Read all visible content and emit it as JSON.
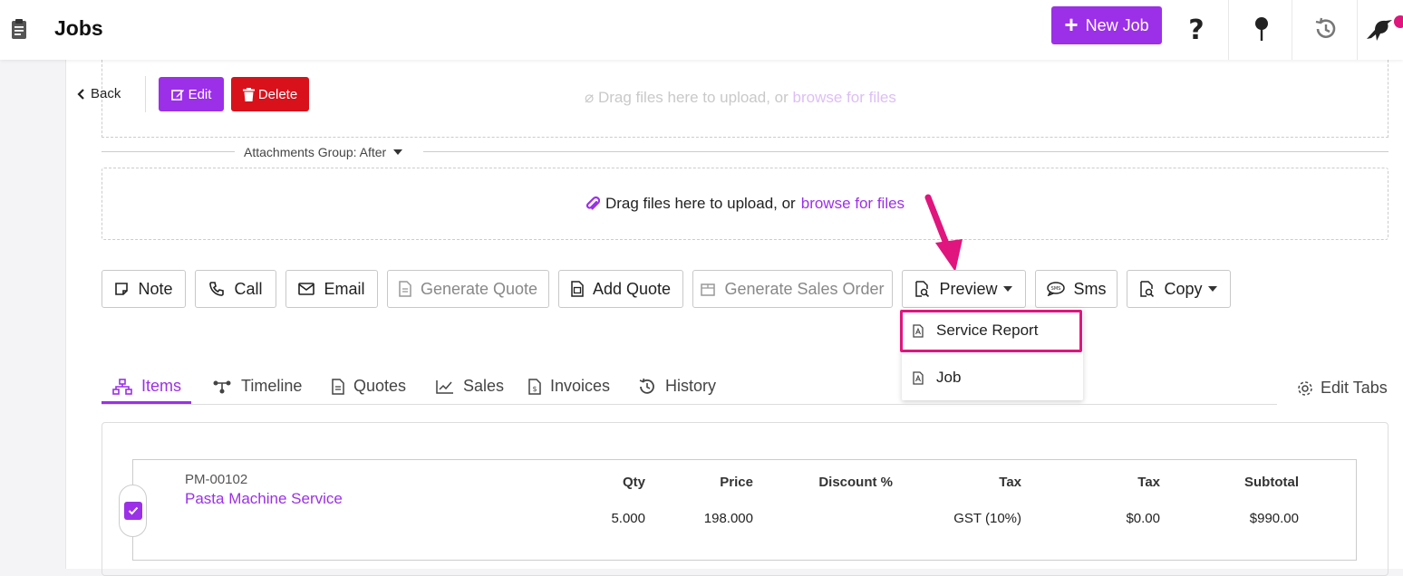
{
  "header": {
    "title": "Jobs",
    "new_job_label": "New Job"
  },
  "toolbar": {
    "back_label": "Back",
    "edit_label": "Edit",
    "delete_label": "Delete"
  },
  "attachments": {
    "faded_text": "Drag files here to upload, or",
    "faded_link": "browse for files",
    "group_label": "Attachments Group: After",
    "drop_text": "Drag files here to upload, or",
    "drop_link": "browse for files"
  },
  "actions": {
    "note": "Note",
    "call": "Call",
    "email": "Email",
    "generate_quote": "Generate Quote",
    "add_quote": "Add Quote",
    "generate_sales_order": "Generate Sales Order",
    "preview": "Preview",
    "sms": "Sms",
    "copy": "Copy"
  },
  "preview_menu": {
    "items": [
      "Service Report",
      "Job"
    ]
  },
  "tabs": {
    "items": [
      "Items",
      "Timeline",
      "Quotes",
      "Sales",
      "Invoices",
      "History"
    ],
    "edit_tabs": "Edit Tabs"
  },
  "item": {
    "sku": "PM-00102",
    "name": "Pasta Machine Service",
    "headers": {
      "qty": "Qty",
      "price": "Price",
      "discount": "Discount %",
      "tax": "Tax",
      "tax_amount": "Tax",
      "subtotal": "Subtotal"
    },
    "values": {
      "qty": "5.000",
      "price": "198.000",
      "tax": "GST (10%)",
      "tax_amount": "$0.00",
      "subtotal": "$990.00"
    }
  },
  "colors": {
    "accent": "#9b30e8",
    "danger": "#d9111b",
    "highlight": "#e0157d"
  }
}
